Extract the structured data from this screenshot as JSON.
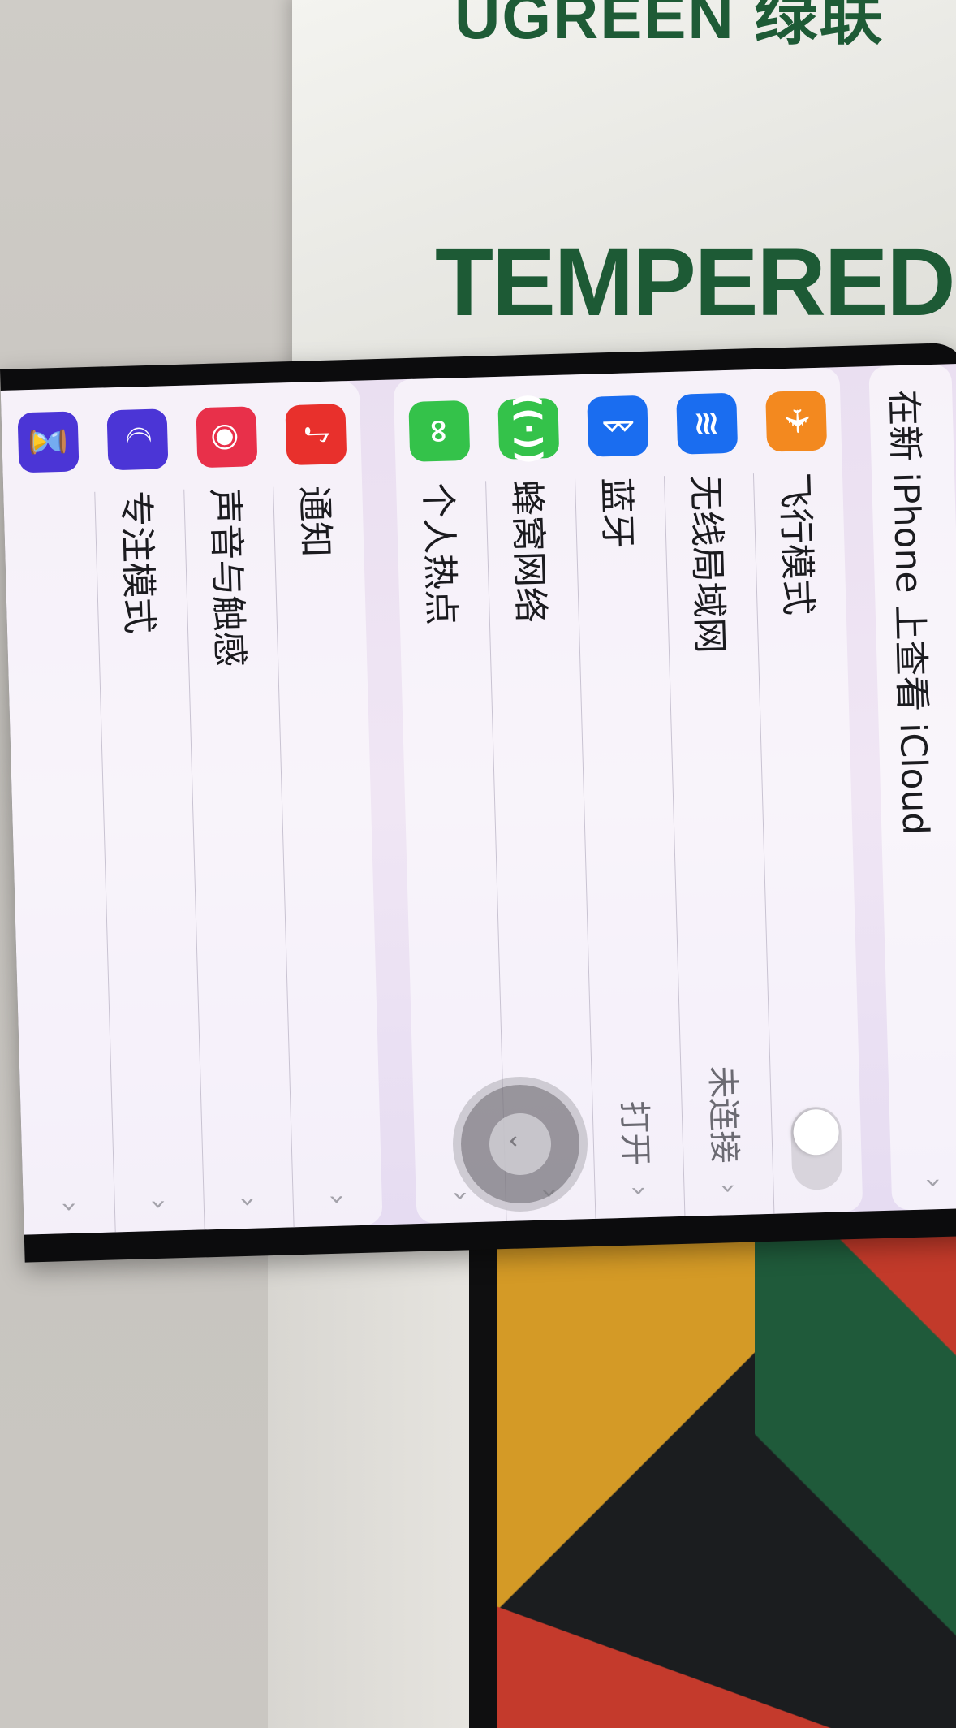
{
  "packaging": {
    "brand": "UGREEN 绿联",
    "product_title": "TEMPERED"
  },
  "banner": {
    "text": "在新 iPhone 上查看 iCloud",
    "chevron": "›"
  },
  "connectivity": [
    {
      "label": "飞行模式",
      "icon": "airplane-icon",
      "glyph": "✈",
      "color": "#f3891f",
      "control": "toggle",
      "toggle_on": false
    },
    {
      "label": "无线局域网",
      "icon": "wifi-icon",
      "glyph": "≋",
      "color": "#1a6df0",
      "value": "未连接",
      "chevron": "›"
    },
    {
      "label": "蓝牙",
      "icon": "bluetooth-icon",
      "glyph": "ᛒ",
      "color": "#1a6df0",
      "value": "打开",
      "chevron": "›"
    },
    {
      "label": "蜂窝网络",
      "icon": "cellular-icon",
      "glyph": "((·))",
      "color": "#34c24a",
      "chevron": "›"
    },
    {
      "label": "个人热点",
      "icon": "hotspot-icon",
      "glyph": "∞",
      "color": "#34c24a",
      "chevron": "›"
    }
  ],
  "system": [
    {
      "label": "通知",
      "icon": "bell-icon",
      "glyph": "♪",
      "color": "#e8302c",
      "chevron": "›"
    },
    {
      "label": "声音与触感",
      "icon": "speaker-icon",
      "glyph": "◉",
      "color": "#e8304a",
      "chevron": "›"
    },
    {
      "label": "专注模式",
      "icon": "moon-icon",
      "glyph": "☾",
      "color": "#4b35d6",
      "chevron": "›"
    },
    {
      "label": "",
      "icon": "hourglass-icon",
      "glyph": "⌛",
      "color": "#4b35d6",
      "chevron": "›"
    }
  ],
  "assistive_touch": {
    "glyph": "⌄"
  }
}
